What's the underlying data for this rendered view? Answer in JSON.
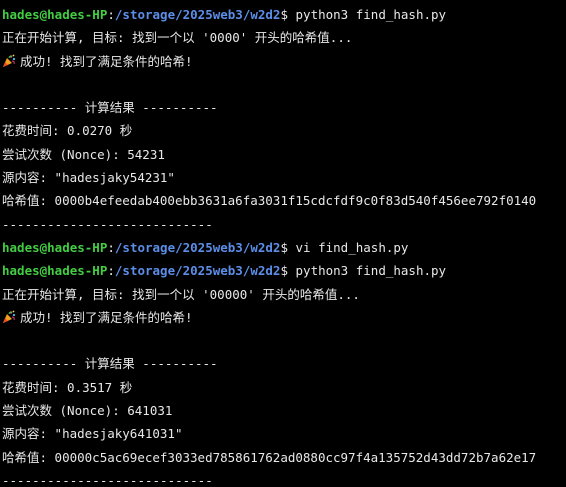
{
  "prompt": {
    "user_host": "hades@hades-HP",
    "colon": ":",
    "path": "/storage/2025web3/w2d2",
    "symbol": "$ "
  },
  "colors": {
    "user": "#44cc44",
    "path": "#5c8ee8",
    "text": "#e8e8e8",
    "background": "#000000"
  },
  "runs": [
    {
      "command": "python3 find_hash.py",
      "start_msg": "正在开始计算, 目标: 找到一个以 '0000' 开头的哈希值...",
      "success_icon": "party-popper-icon",
      "success_msg": "成功! 找到了满足条件的哈希!",
      "result_header": "---------- 计算结果 ----------",
      "time_line": "花费时间: 0.0270 秒",
      "nonce_line": "尝试次数 (Nonce): 54231",
      "source_line": "源内容: \"hadesjaky54231\"",
      "hash_line": "哈希值: 0000b4efeedab400ebb3631a6fa3031f15cdcfdf9c0f83d540f456ee792f0140",
      "footer": "----------------------------"
    },
    {
      "command": "python3 find_hash.py",
      "start_msg": "正在开始计算, 目标: 找到一个以 '00000' 开头的哈希值...",
      "success_icon": "party-popper-icon",
      "success_msg": "成功! 找到了满足条件的哈希!",
      "result_header": "---------- 计算结果 ----------",
      "time_line": "花费时间: 0.3517 秒",
      "nonce_line": "尝试次数 (Nonce): 641031",
      "source_line": "源内容: \"hadesjaky641031\"",
      "hash_line": "哈希值: 00000c5ac69ecef3033ed785861762ad0880cc97f4a135752d43dd72b7a62e17",
      "footer": "----------------------------"
    }
  ],
  "edit_command": "vi find_hash.py"
}
